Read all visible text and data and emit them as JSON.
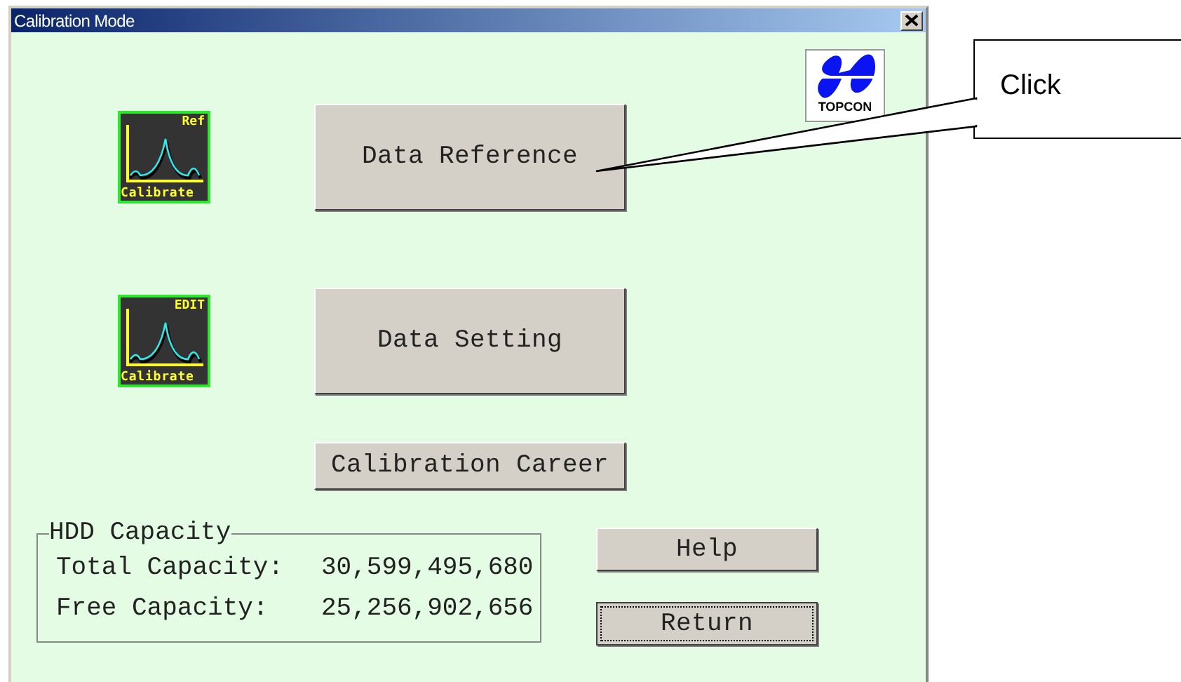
{
  "window": {
    "title": "Calibration Mode",
    "logo_text": "TOPCON"
  },
  "actions": [
    {
      "icon_tag": "Ref",
      "icon_caption": "Calibrate",
      "button": "Data Reference"
    },
    {
      "icon_tag": "EDIT",
      "icon_caption": "Calibrate",
      "button": "Data Setting"
    }
  ],
  "career_button": "Calibration Career",
  "hdd": {
    "title": "HDD Capacity",
    "rows": [
      {
        "label": "Total Capacity:",
        "value": "30,599,495,680"
      },
      {
        "label": "Free Capacity:",
        "value": "25,256,902,656"
      }
    ]
  },
  "buttons": [
    {
      "label": "Help",
      "focused": false
    },
    {
      "label": "Return",
      "focused": true
    }
  ],
  "callout": {
    "text": "Click"
  }
}
